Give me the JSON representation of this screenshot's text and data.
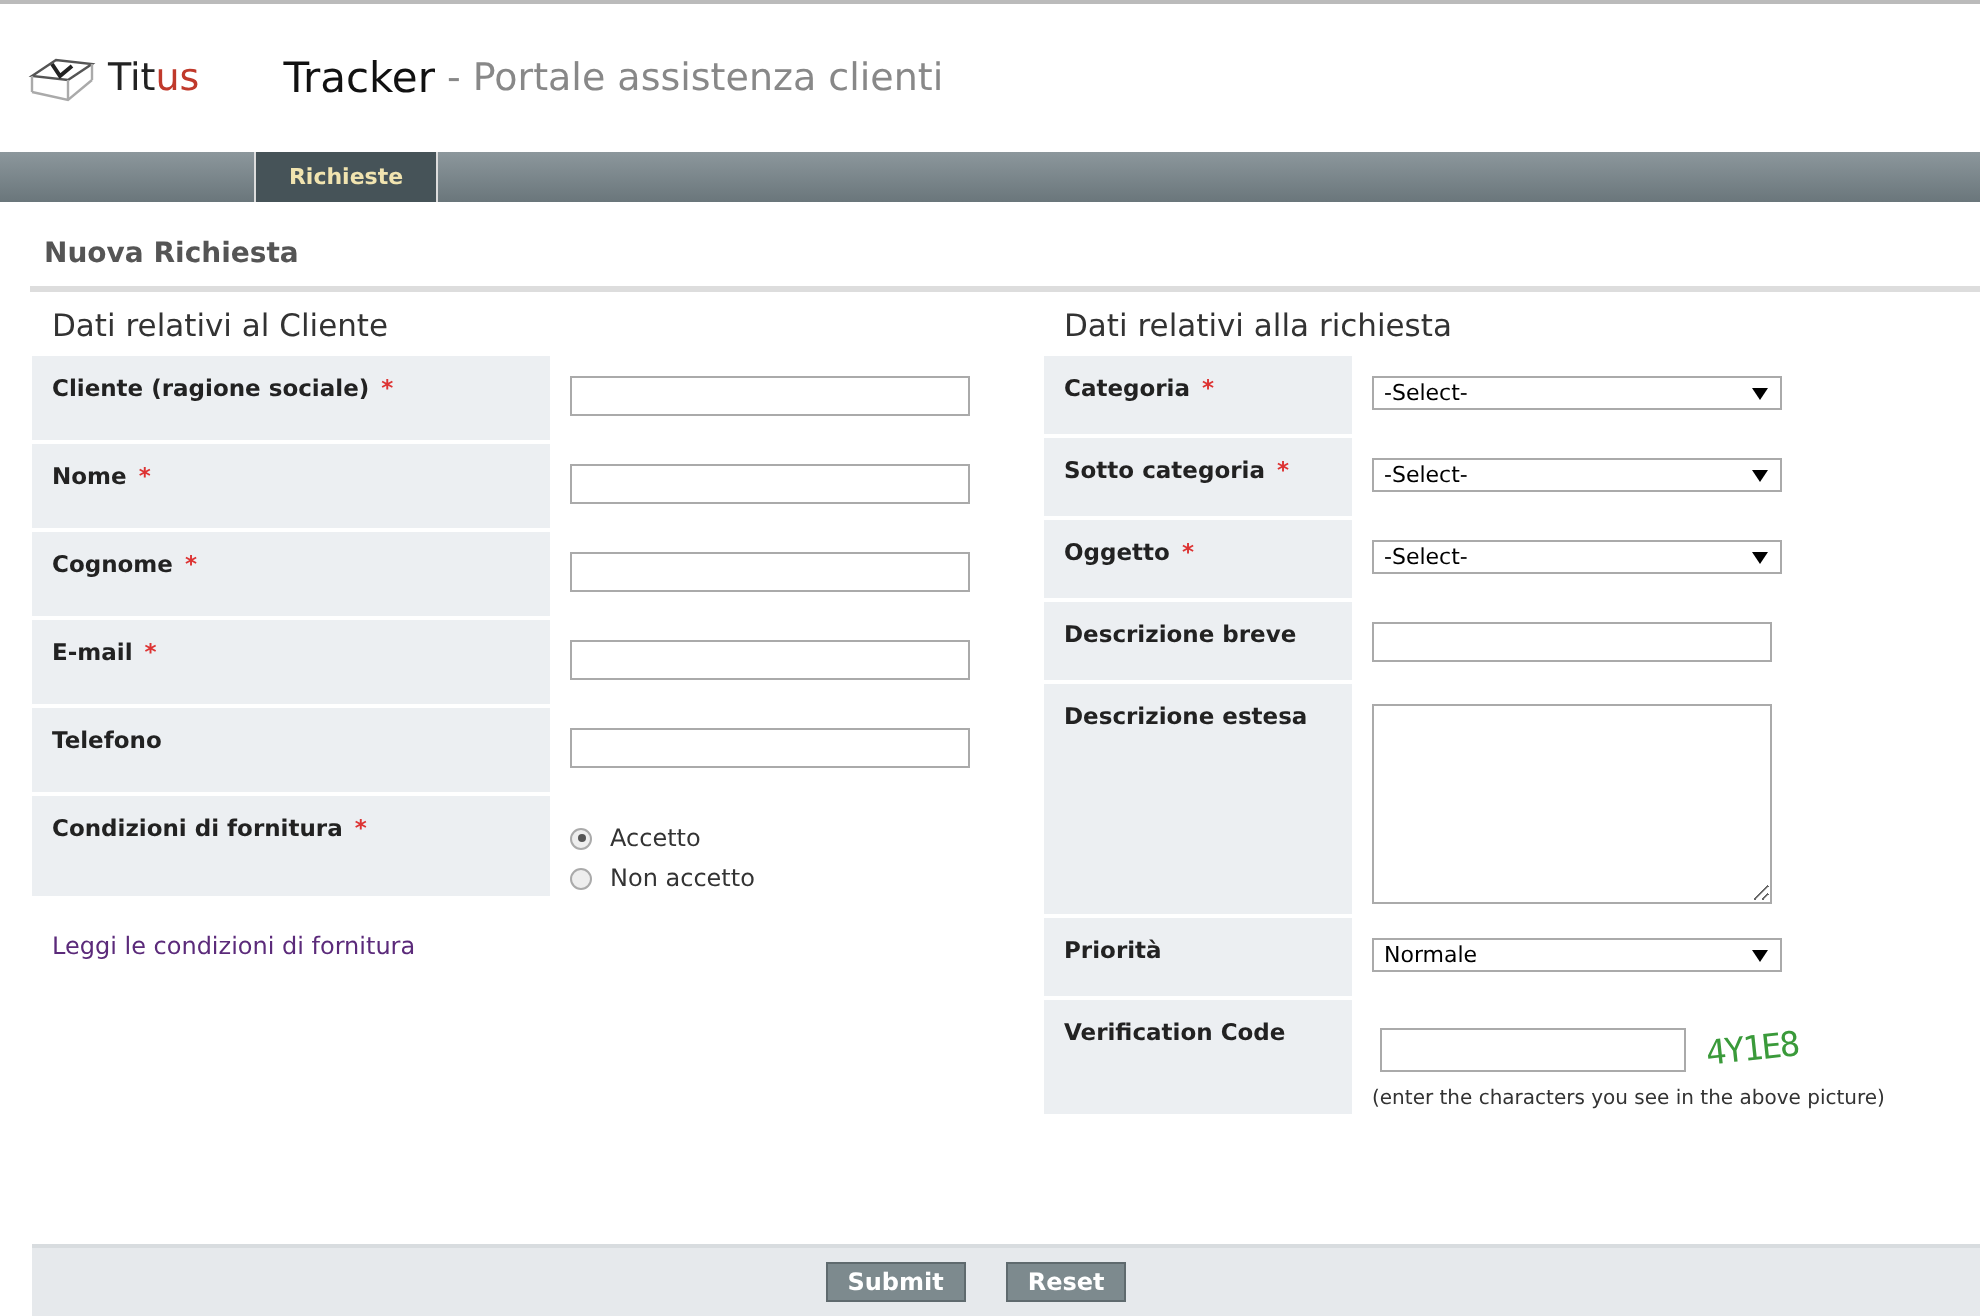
{
  "header": {
    "logo_text": "Tit",
    "logo_accent": "us",
    "app_name": "Tracker",
    "subtitle": "- Portale assistenza clienti"
  },
  "nav": {
    "tabs": [
      {
        "label": "Richieste",
        "selected": true
      }
    ]
  },
  "page_title": "Nuova Richiesta",
  "left": {
    "title": "Dati relativi al Cliente",
    "rows": [
      {
        "label": "Cliente (ragione sociale)",
        "required_mark": "*",
        "kind": "text"
      },
      {
        "label": "Nome",
        "required_mark": "*",
        "kind": "text"
      },
      {
        "label": "Cognome",
        "required_mark": "*",
        "kind": "text"
      },
      {
        "label": "E-mail",
        "required_mark": "*",
        "kind": "text"
      },
      {
        "label": "Telefono",
        "kind": "text"
      },
      {
        "label": "Condizioni di fornitura",
        "required_mark": "*",
        "kind": "radio",
        "options": [
          {
            "label": "Accetto",
            "selected": true
          },
          {
            "label": "Non accetto",
            "selected": false
          }
        ]
      }
    ],
    "link": "Leggi le condizioni di fornitura"
  },
  "right": {
    "title": "Dati relativi alla richiesta",
    "rows": [
      {
        "label": "Categoria",
        "required_mark": "*",
        "kind": "select",
        "value": "-Select-"
      },
      {
        "label": "Sotto categoria",
        "required_mark": "*",
        "kind": "select",
        "value": "-Select-"
      },
      {
        "label": "Oggetto",
        "required_mark": "*",
        "kind": "select",
        "value": "-Select-"
      },
      {
        "label": "Descrizione breve",
        "kind": "text"
      },
      {
        "label": "Descrizione estesa",
        "kind": "textarea"
      },
      {
        "label": "Priorità",
        "kind": "select",
        "value": "Normale"
      },
      {
        "label": "Verification Code",
        "kind": "captcha",
        "code": "4Y1E8",
        "hint": "(enter the characters you see in the above picture)"
      }
    ]
  },
  "buttons": [
    "Submit",
    "Reset"
  ]
}
